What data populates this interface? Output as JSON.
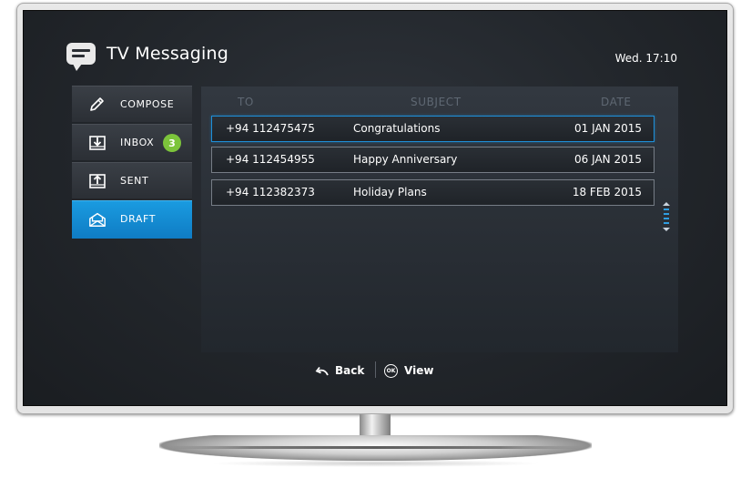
{
  "app": {
    "title": "TV Messaging",
    "clock": "Wed. 17:10"
  },
  "sidebar": {
    "items": [
      {
        "label": "COMPOSE",
        "icon": "pencil-icon"
      },
      {
        "label": "INBOX",
        "icon": "inbox-icon",
        "badge": "3"
      },
      {
        "label": "SENT",
        "icon": "sent-icon"
      },
      {
        "label": "DRAFT",
        "icon": "draft-icon",
        "active": true
      }
    ]
  },
  "table": {
    "columns": {
      "to": "TO",
      "subject": "SUBJECT",
      "date": "DATE"
    },
    "rows": [
      {
        "to": "+94 112475475",
        "subject": "Congratulations",
        "date": "01 JAN 2015",
        "selected": true
      },
      {
        "to": "+94 112454955",
        "subject": "Happy Anniversary",
        "date": "06 JAN 2015"
      },
      {
        "to": "+94 112382373",
        "subject": "Holiday Plans",
        "date": "18 FEB 2015"
      }
    ]
  },
  "footer": {
    "back_label": "Back",
    "ok_icon_text": "OK",
    "view_label": "View"
  },
  "colors": {
    "accent": "#1a9be0",
    "badge": "#7cc43b",
    "screen_bg": "#22262b"
  }
}
